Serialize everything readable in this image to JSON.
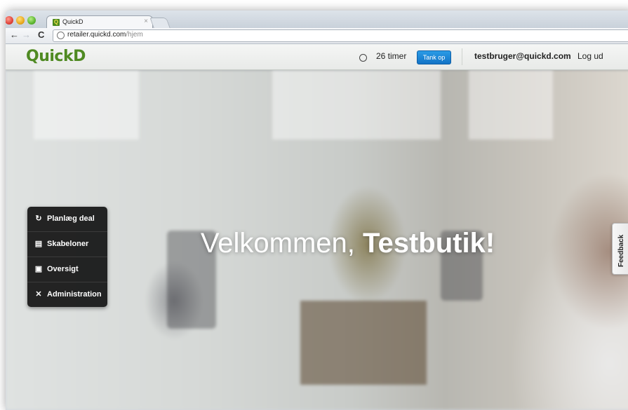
{
  "browser": {
    "tab_title": "QuickD",
    "tab_favicon_letter": "Q",
    "tab_close": "×",
    "url_host": "retailer.quickd.com",
    "url_path": "/hjem",
    "icons": [
      "back-arrow-icon",
      "forward-arrow-icon",
      "reload-icon",
      "globe-icon"
    ]
  },
  "header": {
    "logo": "QuickD",
    "logo_color": "#4f8a22",
    "timer_icon": "clock-icon",
    "hours_left": "26 timer",
    "topup_label": "Tank op",
    "topup_color": "#1f86d6",
    "user_email": "testbruger@quickd.com",
    "logout_label": "Log ud"
  },
  "sidebar": {
    "items": [
      {
        "label": "Planlæg deal",
        "icon": "refresh-icon"
      },
      {
        "label": "Skabeloner",
        "icon": "template-icon"
      },
      {
        "label": "Oversigt",
        "icon": "overview-icon"
      },
      {
        "label": "Administration",
        "icon": "tools-icon"
      }
    ]
  },
  "main": {
    "welcome_prefix": "Velkommen, ",
    "welcome_name": "Testbutik!"
  },
  "feedback": {
    "label": "Feedback"
  }
}
